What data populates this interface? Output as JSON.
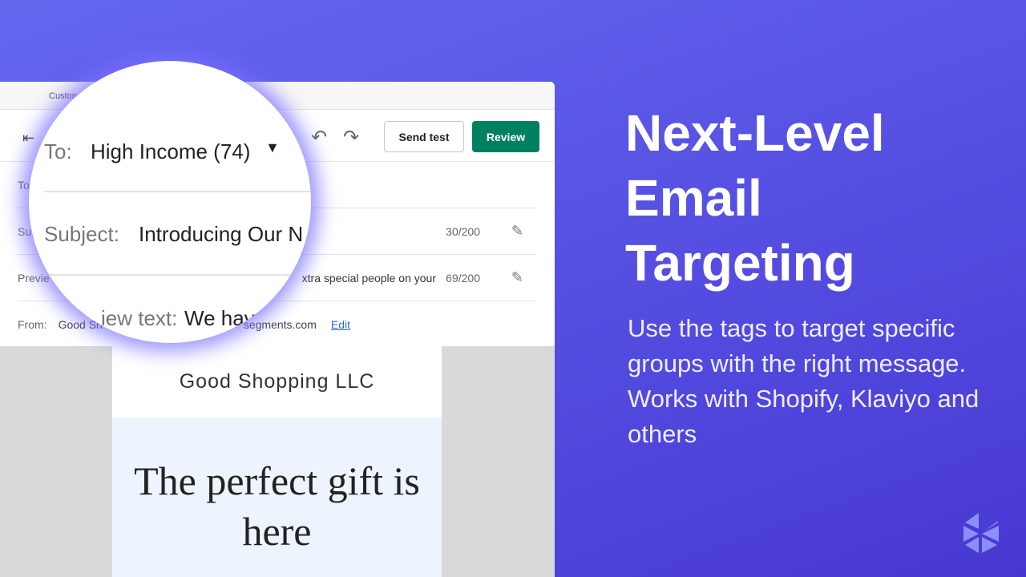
{
  "app": {
    "top_tab": "Custon"
  },
  "toolbar": {
    "send_test": "Send test",
    "review": "Review"
  },
  "fields": {
    "to_label": "To",
    "subject_label": "Su",
    "subject_count": "30/200",
    "preview_label": "Previe",
    "preview_value": "xtra special people on your",
    "preview_count": "69/200",
    "from_label": "From:",
    "from_value": "Good Sh",
    "from_email": "segments.com",
    "edit": "Edit"
  },
  "email": {
    "brand": "Good Shopping LLC",
    "headline": "The perfect gift is here"
  },
  "magnifier": {
    "to_label": "To:",
    "to_value": "High Income (74)",
    "subject_label": "Subject:",
    "subject_value": "Introducing Our N",
    "preview_label": "iew text:",
    "preview_value": "We hav"
  },
  "promo": {
    "title": "Next-Level Email Targeting",
    "body": "Use the tags to target specific groups with the right message. Works with Shopify, Klaviyo and others"
  },
  "colors": {
    "review": "#008060",
    "link": "#2c6ecb",
    "accent": "#5650e2"
  },
  "icons": {
    "exit": "exit-icon",
    "undo": "undo-icon",
    "redo": "redo-icon",
    "wand": "magic-wand-icon",
    "dropdown": "caret-down-icon"
  }
}
